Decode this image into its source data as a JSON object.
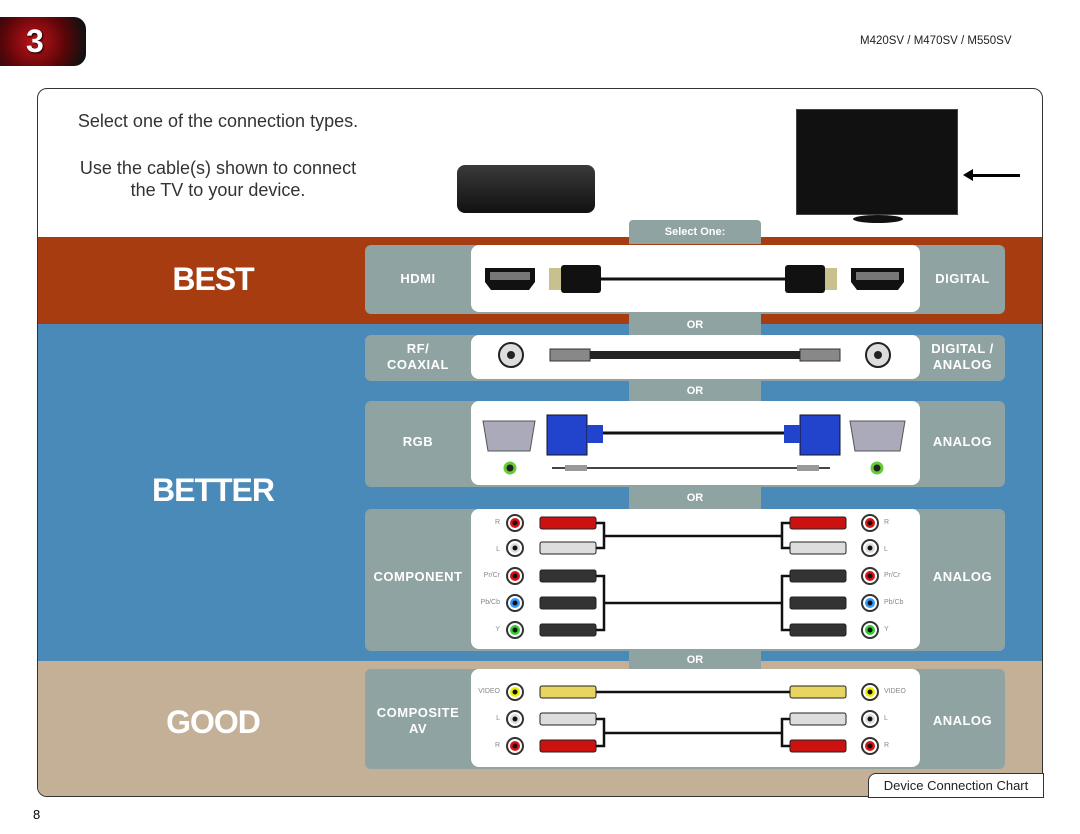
{
  "header": {
    "chapter_number": "3",
    "models": "M420SV / M470SV / M550SV"
  },
  "intro": {
    "line1": "Select one of the connection types.",
    "line2a": "Use the cable(s) shown to connect",
    "line2b": "the TV to your device."
  },
  "select_one": "Select One:",
  "or_label": "OR",
  "grades": {
    "best": "BEST",
    "better": "BETTER",
    "good": "GOOD"
  },
  "colors": {
    "best": "#a63c10",
    "better": "#4a8ab8",
    "good": "#c3b096",
    "panel": "#8fa3a2"
  },
  "connections": [
    {
      "name": "HDMI",
      "signal": "DIGITAL"
    },
    {
      "name": "RF/ COAXIAL",
      "name_l1": "RF/",
      "name_l2": "COAXIAL",
      "signal": "DIGITAL / ANALOG",
      "signal_l1": "DIGITAL /",
      "signal_l2": "ANALOG"
    },
    {
      "name": "RGB",
      "signal": "ANALOG"
    },
    {
      "name": "COMPONENT",
      "signal": "ANALOG",
      "jacks": [
        "R",
        "L",
        "Pr/Cr",
        "Pb/Cb",
        "Y"
      ]
    },
    {
      "name": "COMPOSITE AV",
      "name_l1": "COMPOSITE",
      "name_l2": "AV",
      "signal": "ANALOG",
      "jacks": [
        "VIDEO",
        "L",
        "R"
      ]
    }
  ],
  "footer": {
    "title": "Device Connection Chart",
    "page": "8"
  }
}
